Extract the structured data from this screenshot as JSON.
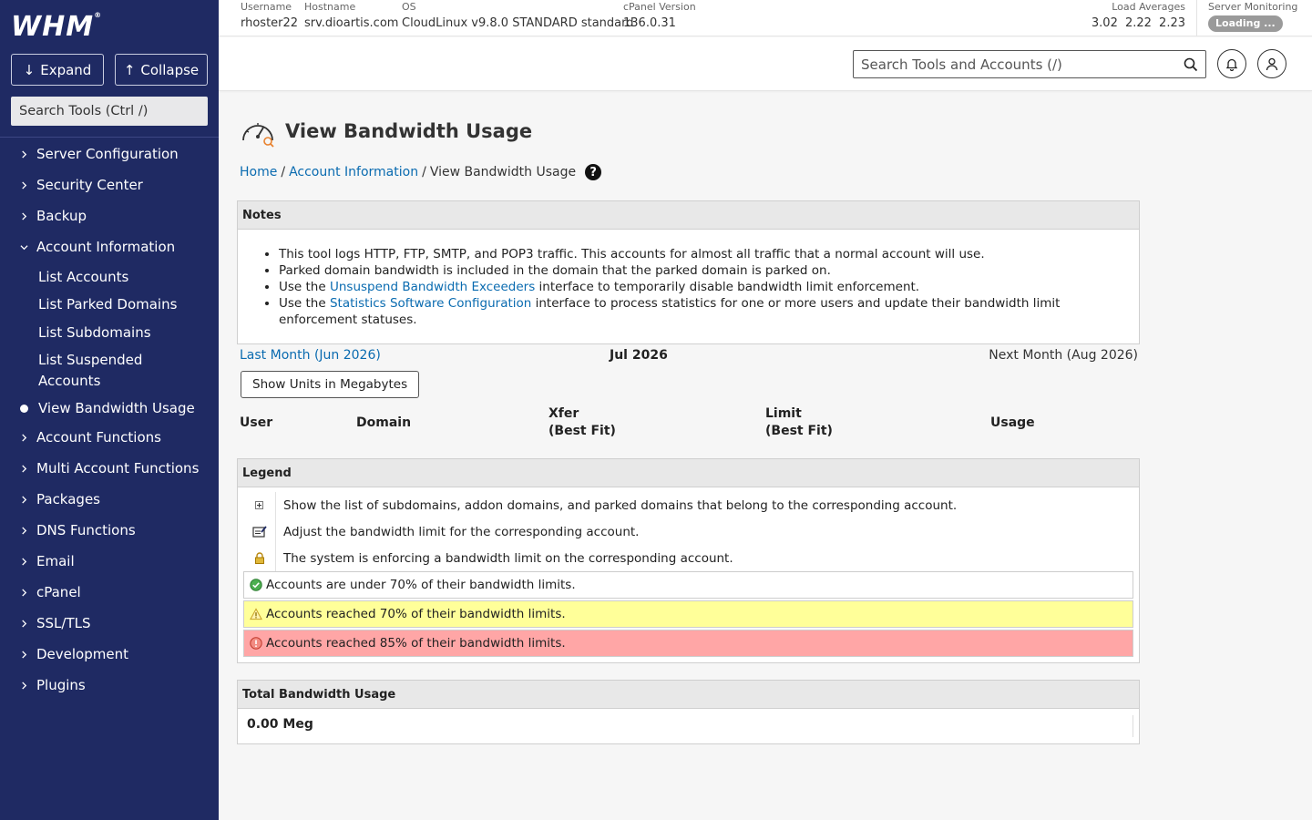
{
  "sidebar": {
    "logo": "WHM",
    "expand_label": "Expand",
    "collapse_label": "Collapse",
    "search_placeholder": "Search Tools (Ctrl /)",
    "items": [
      {
        "label": "Server Configuration"
      },
      {
        "label": "Security Center"
      },
      {
        "label": "Backup"
      },
      {
        "label": "Account Information"
      },
      {
        "label": "Account Functions"
      },
      {
        "label": "Multi Account Functions"
      },
      {
        "label": "Packages"
      },
      {
        "label": "DNS Functions"
      },
      {
        "label": "Email"
      },
      {
        "label": "cPanel"
      },
      {
        "label": "SSL/TLS"
      },
      {
        "label": "Development"
      },
      {
        "label": "Plugins"
      }
    ],
    "sub_items": [
      {
        "label": "List Accounts"
      },
      {
        "label": "List Parked Domains"
      },
      {
        "label": "List Subdomains"
      },
      {
        "label": "List Suspended Accounts"
      },
      {
        "label": "View Bandwidth Usage"
      }
    ]
  },
  "topbar": {
    "username_label": "Username",
    "username": "rhoster22",
    "hostname_label": "Hostname",
    "hostname": "srv.dioartis.com",
    "os_label": "OS",
    "os": "CloudLinux v9.8.0 STANDARD standard",
    "cpanel_label": "cPanel Version",
    "cpanel_version": "136.0.31",
    "load_label": "Load Averages",
    "load_values": "3.02 2.22 2.23",
    "monitor_label": "Server Monitoring",
    "monitor_status": "Loading ..."
  },
  "header": {
    "search_placeholder": "Search Tools and Accounts (/)"
  },
  "page": {
    "title": "View Bandwidth Usage",
    "breadcrumb": {
      "home": "Home",
      "section": "Account Information",
      "current": "View Bandwidth Usage"
    },
    "notes": {
      "heading": "Notes",
      "items": [
        {
          "pre": "This tool logs HTTP, FTP, SMTP, and POP3 traffic. This accounts for almost all traffic that a normal account will use.",
          "link": "",
          "post": ""
        },
        {
          "pre": "Parked domain bandwidth is included in the domain that the parked domain is parked on.",
          "link": "",
          "post": ""
        },
        {
          "pre": "Use the ",
          "link": "Unsuspend Bandwidth Exceeders",
          "post": " interface to temporarily disable bandwidth limit enforcement."
        },
        {
          "pre": "Use the ",
          "link": "Statistics Software Configuration",
          "post": " interface to process statistics for one or more users and update their bandwidth limit enforcement statuses."
        }
      ]
    },
    "months": {
      "prev": "Last Month (Jun 2026)",
      "current": "Jul 2026",
      "next": "Next Month (Aug 2026)"
    },
    "units_button": "Show Units in Megabytes",
    "table_headers": {
      "user": "User",
      "domain": "Domain",
      "xfer_1": "Xfer",
      "xfer_2": "(Best Fit)",
      "limit_1": "Limit",
      "limit_2": "(Best Fit)",
      "usage": "Usage"
    },
    "legend": {
      "heading": "Legend",
      "rows": [
        {
          "text": "Show the list of subdomains, addon domains, and parked domains that belong to the corresponding account."
        },
        {
          "text": "Adjust the bandwidth limit for the corresponding account."
        },
        {
          "text": "The system is enforcing a bandwidth limit on the corresponding account."
        },
        {
          "text": "Accounts are under 70% of their bandwidth limits."
        },
        {
          "text": "Accounts reached 70% of their bandwidth limits."
        },
        {
          "text": "Accounts reached 85% of their bandwidth limits."
        }
      ],
      "colors": {
        "ok": "#ffffff",
        "warn": "#ffff99",
        "danger": "#ffa6a6"
      }
    },
    "total": {
      "heading": "Total Bandwidth Usage",
      "value": "0.00 Meg"
    }
  },
  "colors": {
    "sidebar_bg": "#1f2a63",
    "link": "#0a6bb0"
  }
}
